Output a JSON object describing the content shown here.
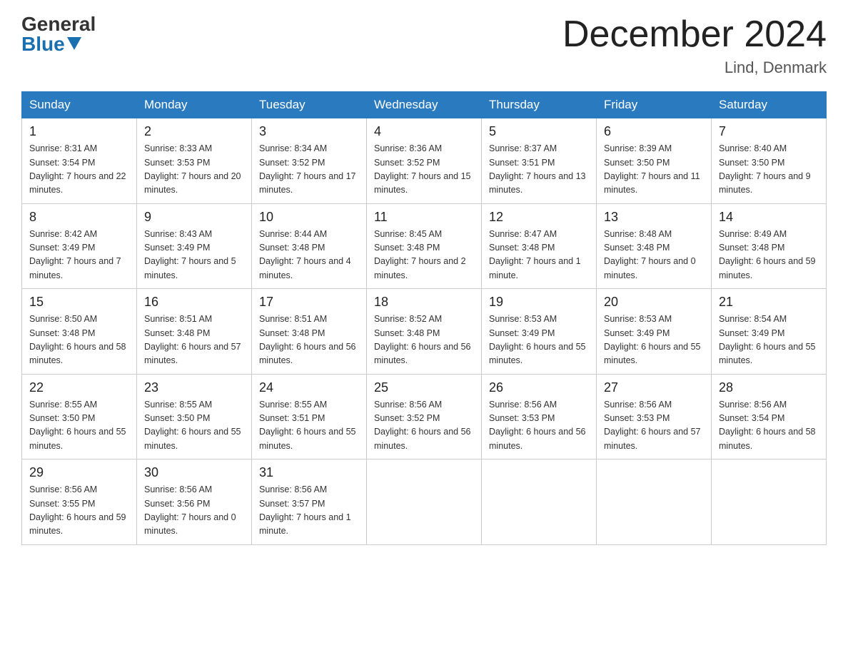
{
  "logo": {
    "general": "General",
    "blue": "Blue"
  },
  "title": "December 2024",
  "location": "Lind, Denmark",
  "days_of_week": [
    "Sunday",
    "Monday",
    "Tuesday",
    "Wednesday",
    "Thursday",
    "Friday",
    "Saturday"
  ],
  "weeks": [
    [
      {
        "day": "1",
        "sunrise": "8:31 AM",
        "sunset": "3:54 PM",
        "daylight": "7 hours and 22 minutes."
      },
      {
        "day": "2",
        "sunrise": "8:33 AM",
        "sunset": "3:53 PM",
        "daylight": "7 hours and 20 minutes."
      },
      {
        "day": "3",
        "sunrise": "8:34 AM",
        "sunset": "3:52 PM",
        "daylight": "7 hours and 17 minutes."
      },
      {
        "day": "4",
        "sunrise": "8:36 AM",
        "sunset": "3:52 PM",
        "daylight": "7 hours and 15 minutes."
      },
      {
        "day": "5",
        "sunrise": "8:37 AM",
        "sunset": "3:51 PM",
        "daylight": "7 hours and 13 minutes."
      },
      {
        "day": "6",
        "sunrise": "8:39 AM",
        "sunset": "3:50 PM",
        "daylight": "7 hours and 11 minutes."
      },
      {
        "day": "7",
        "sunrise": "8:40 AM",
        "sunset": "3:50 PM",
        "daylight": "7 hours and 9 minutes."
      }
    ],
    [
      {
        "day": "8",
        "sunrise": "8:42 AM",
        "sunset": "3:49 PM",
        "daylight": "7 hours and 7 minutes."
      },
      {
        "day": "9",
        "sunrise": "8:43 AM",
        "sunset": "3:49 PM",
        "daylight": "7 hours and 5 minutes."
      },
      {
        "day": "10",
        "sunrise": "8:44 AM",
        "sunset": "3:48 PM",
        "daylight": "7 hours and 4 minutes."
      },
      {
        "day": "11",
        "sunrise": "8:45 AM",
        "sunset": "3:48 PM",
        "daylight": "7 hours and 2 minutes."
      },
      {
        "day": "12",
        "sunrise": "8:47 AM",
        "sunset": "3:48 PM",
        "daylight": "7 hours and 1 minute."
      },
      {
        "day": "13",
        "sunrise": "8:48 AM",
        "sunset": "3:48 PM",
        "daylight": "7 hours and 0 minutes."
      },
      {
        "day": "14",
        "sunrise": "8:49 AM",
        "sunset": "3:48 PM",
        "daylight": "6 hours and 59 minutes."
      }
    ],
    [
      {
        "day": "15",
        "sunrise": "8:50 AM",
        "sunset": "3:48 PM",
        "daylight": "6 hours and 58 minutes."
      },
      {
        "day": "16",
        "sunrise": "8:51 AM",
        "sunset": "3:48 PM",
        "daylight": "6 hours and 57 minutes."
      },
      {
        "day": "17",
        "sunrise": "8:51 AM",
        "sunset": "3:48 PM",
        "daylight": "6 hours and 56 minutes."
      },
      {
        "day": "18",
        "sunrise": "8:52 AM",
        "sunset": "3:48 PM",
        "daylight": "6 hours and 56 minutes."
      },
      {
        "day": "19",
        "sunrise": "8:53 AM",
        "sunset": "3:49 PM",
        "daylight": "6 hours and 55 minutes."
      },
      {
        "day": "20",
        "sunrise": "8:53 AM",
        "sunset": "3:49 PM",
        "daylight": "6 hours and 55 minutes."
      },
      {
        "day": "21",
        "sunrise": "8:54 AM",
        "sunset": "3:49 PM",
        "daylight": "6 hours and 55 minutes."
      }
    ],
    [
      {
        "day": "22",
        "sunrise": "8:55 AM",
        "sunset": "3:50 PM",
        "daylight": "6 hours and 55 minutes."
      },
      {
        "day": "23",
        "sunrise": "8:55 AM",
        "sunset": "3:50 PM",
        "daylight": "6 hours and 55 minutes."
      },
      {
        "day": "24",
        "sunrise": "8:55 AM",
        "sunset": "3:51 PM",
        "daylight": "6 hours and 55 minutes."
      },
      {
        "day": "25",
        "sunrise": "8:56 AM",
        "sunset": "3:52 PM",
        "daylight": "6 hours and 56 minutes."
      },
      {
        "day": "26",
        "sunrise": "8:56 AM",
        "sunset": "3:53 PM",
        "daylight": "6 hours and 56 minutes."
      },
      {
        "day": "27",
        "sunrise": "8:56 AM",
        "sunset": "3:53 PM",
        "daylight": "6 hours and 57 minutes."
      },
      {
        "day": "28",
        "sunrise": "8:56 AM",
        "sunset": "3:54 PM",
        "daylight": "6 hours and 58 minutes."
      }
    ],
    [
      {
        "day": "29",
        "sunrise": "8:56 AM",
        "sunset": "3:55 PM",
        "daylight": "6 hours and 59 minutes."
      },
      {
        "day": "30",
        "sunrise": "8:56 AM",
        "sunset": "3:56 PM",
        "daylight": "7 hours and 0 minutes."
      },
      {
        "day": "31",
        "sunrise": "8:56 AM",
        "sunset": "3:57 PM",
        "daylight": "7 hours and 1 minute."
      },
      null,
      null,
      null,
      null
    ]
  ],
  "labels": {
    "sunrise": "Sunrise:",
    "sunset": "Sunset:",
    "daylight": "Daylight:"
  }
}
